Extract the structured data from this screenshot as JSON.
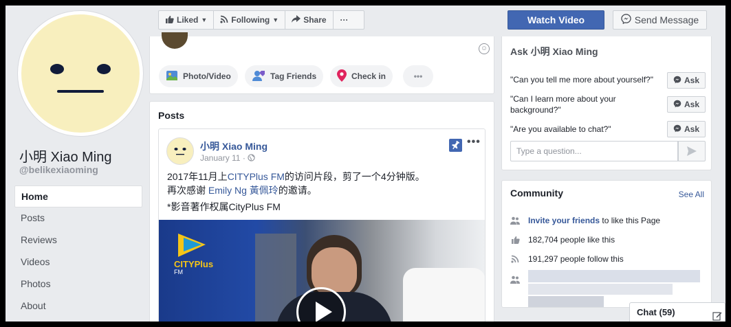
{
  "page": {
    "name": "小明 Xiao Ming",
    "handle": "@belikexiaoming"
  },
  "left_nav": {
    "items": [
      {
        "label": "Home",
        "active": true
      },
      {
        "label": "Posts"
      },
      {
        "label": "Reviews"
      },
      {
        "label": "Videos"
      },
      {
        "label": "Photos"
      },
      {
        "label": "About"
      }
    ]
  },
  "action_bar": {
    "liked_label": "Liked",
    "following_label": "Following",
    "share_label": "Share",
    "more_label": "···"
  },
  "cta": {
    "watch_label": "Watch Video",
    "message_label": "Send Message"
  },
  "composer": {
    "photo_video_label": "Photo/Video",
    "tag_friends_label": "Tag Friends",
    "check_in_label": "Check in",
    "more_label": "•••"
  },
  "posts": {
    "title": "Posts",
    "pinned_post": {
      "author": "小明 Xiao Ming",
      "date": "January 11 · ",
      "line1_a": "2017年11月上",
      "line1_link": "CITYPlus FM",
      "line1_b": "的访问片段，剪了一个4分钟版。",
      "line2_a": "再次感谢 ",
      "line2_link": "Emily Ng 黃佩玲",
      "line2_b": "的邀请。",
      "line3": "*影音著作权属CityPlus FM",
      "video_logo_text": "CITYPlus",
      "video_logo_sub": "FM"
    }
  },
  "ask": {
    "title": "Ask 小明 Xiao Ming",
    "questions": [
      "\"Can you tell me more about yourself?\"",
      "\"Can I learn more about your background?\"",
      "\"Are you available to chat?\""
    ],
    "ask_label": "Ask",
    "input_placeholder": "Type a question..."
  },
  "community": {
    "title": "Community",
    "see_all": "See All",
    "invite_link": "Invite your friends",
    "invite_rest": " to like this Page",
    "likes_text": "182,704 people like this",
    "follows_text": "191,297 people follow this"
  },
  "chat": {
    "label": "Chat (59)"
  },
  "colors": {
    "brand_blue": "#4267b2",
    "link_blue": "#365899",
    "avatar_yellow": "#f8efbe"
  }
}
